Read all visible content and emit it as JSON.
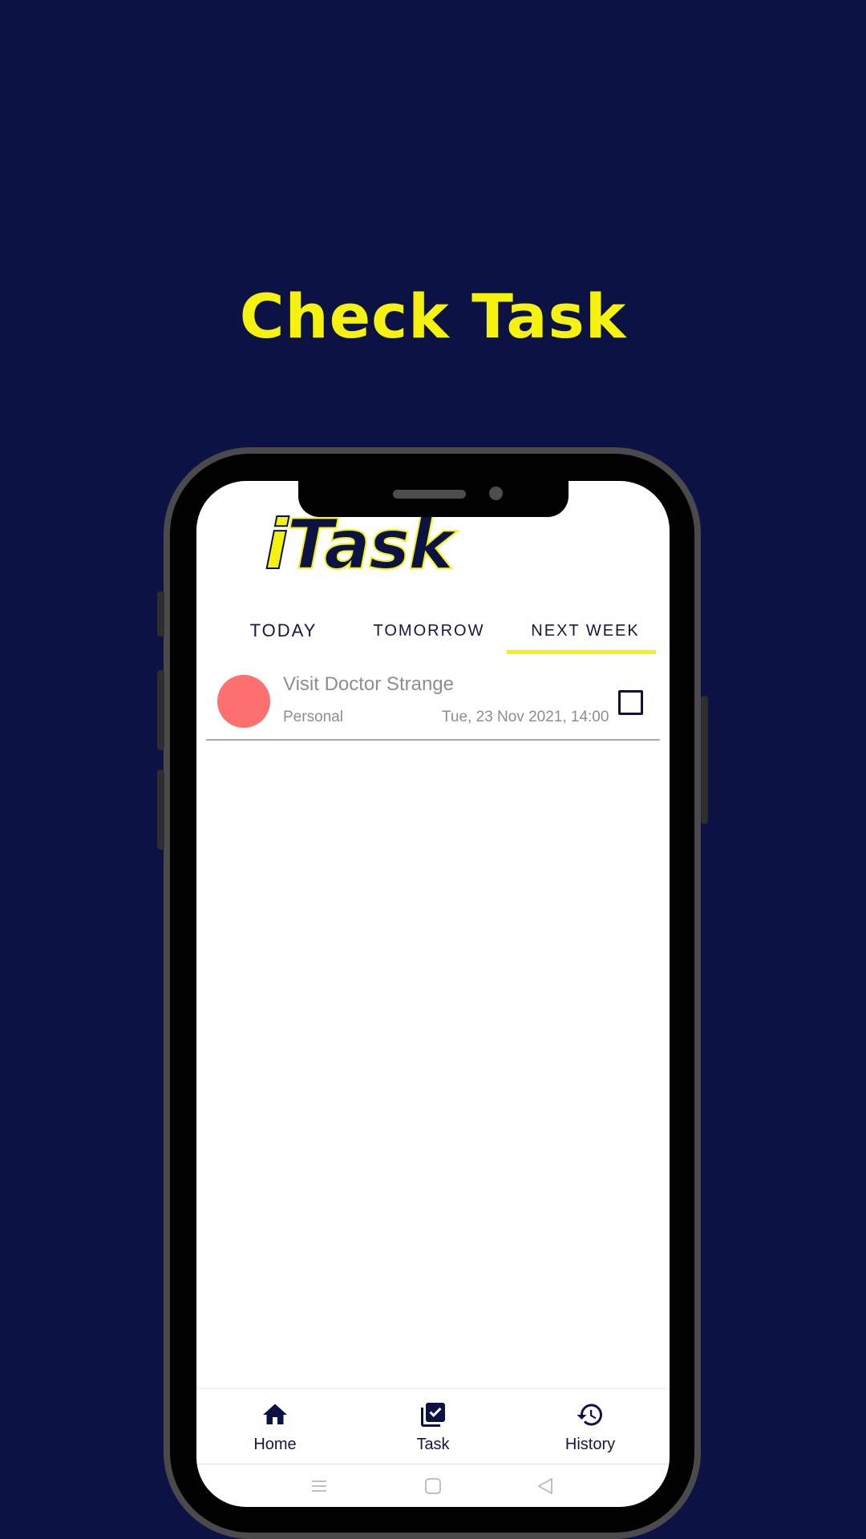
{
  "headline": "Check Task",
  "app": {
    "logo_i": "i",
    "logo_rest": "Task"
  },
  "tabs": [
    {
      "label": "TODAY"
    },
    {
      "label": "TOMORROW"
    },
    {
      "label": "NEXT WEEK",
      "selected": true
    }
  ],
  "tasks": [
    {
      "title": "Visit Doctor Strange",
      "category": "Personal",
      "due": "Tue, 23 Nov 2021, 14:00",
      "checked": false,
      "color": "#fe6f6f"
    }
  ],
  "bottom_nav": [
    {
      "label": "Home",
      "icon": "home-icon"
    },
    {
      "label": "Task",
      "icon": "task-check-icon"
    },
    {
      "label": "History",
      "icon": "history-icon"
    }
  ],
  "system_nav": [
    "menu-icon",
    "home-square-icon",
    "back-triangle-icon"
  ],
  "colors": {
    "background": "#0c1243",
    "accent": "#f5f20f",
    "primary": "#0c1243",
    "task_dot": "#fe6f6f"
  }
}
